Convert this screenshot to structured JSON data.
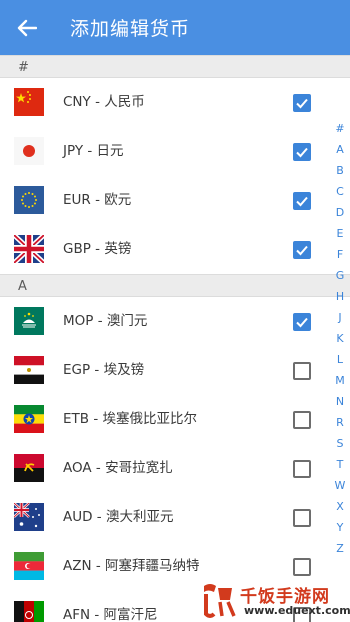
{
  "header": {
    "title": "添加编辑货币"
  },
  "sections": [
    {
      "header": "#",
      "items": [
        {
          "label": "CNY - 人民币",
          "flag": "cn-flag-icon",
          "checked": true
        },
        {
          "label": "JPY - 日元",
          "flag": "jp-flag-icon",
          "checked": true
        },
        {
          "label": "EUR - 欧元",
          "flag": "eu-flag-icon",
          "checked": true
        },
        {
          "label": "GBP - 英镑",
          "flag": "gb-flag-icon",
          "checked": true
        }
      ]
    },
    {
      "header": "A",
      "items": [
        {
          "label": "MOP - 澳门元",
          "flag": "mo-flag-icon",
          "checked": true
        },
        {
          "label": "EGP - 埃及镑",
          "flag": "eg-flag-icon",
          "checked": false
        },
        {
          "label": "ETB - 埃塞俄比亚比尔",
          "flag": "et-flag-icon",
          "checked": false
        },
        {
          "label": "AOA - 安哥拉宽扎",
          "flag": "ao-flag-icon",
          "checked": false
        },
        {
          "label": "AUD - 澳大利亚元",
          "flag": "au-flag-icon",
          "checked": false
        },
        {
          "label": "AZN - 阿塞拜疆马纳特",
          "flag": "az-flag-icon",
          "checked": false
        },
        {
          "label": "AFN - 阿富汗尼",
          "flag": "af-flag-icon",
          "checked": false
        }
      ]
    }
  ],
  "index_letters": [
    "#",
    "A",
    "B",
    "C",
    "D",
    "E",
    "F",
    "G",
    "H",
    "J",
    "K",
    "L",
    "M",
    "N",
    "R",
    "S",
    "T",
    "W",
    "X",
    "Y",
    "Z"
  ],
  "watermark": {
    "name": "千饭手游网",
    "url": "www.eduext.com"
  },
  "colors": {
    "appbar": "#4a8fe2",
    "accent": "#3b84d9",
    "watermark": "#d23a1d"
  }
}
